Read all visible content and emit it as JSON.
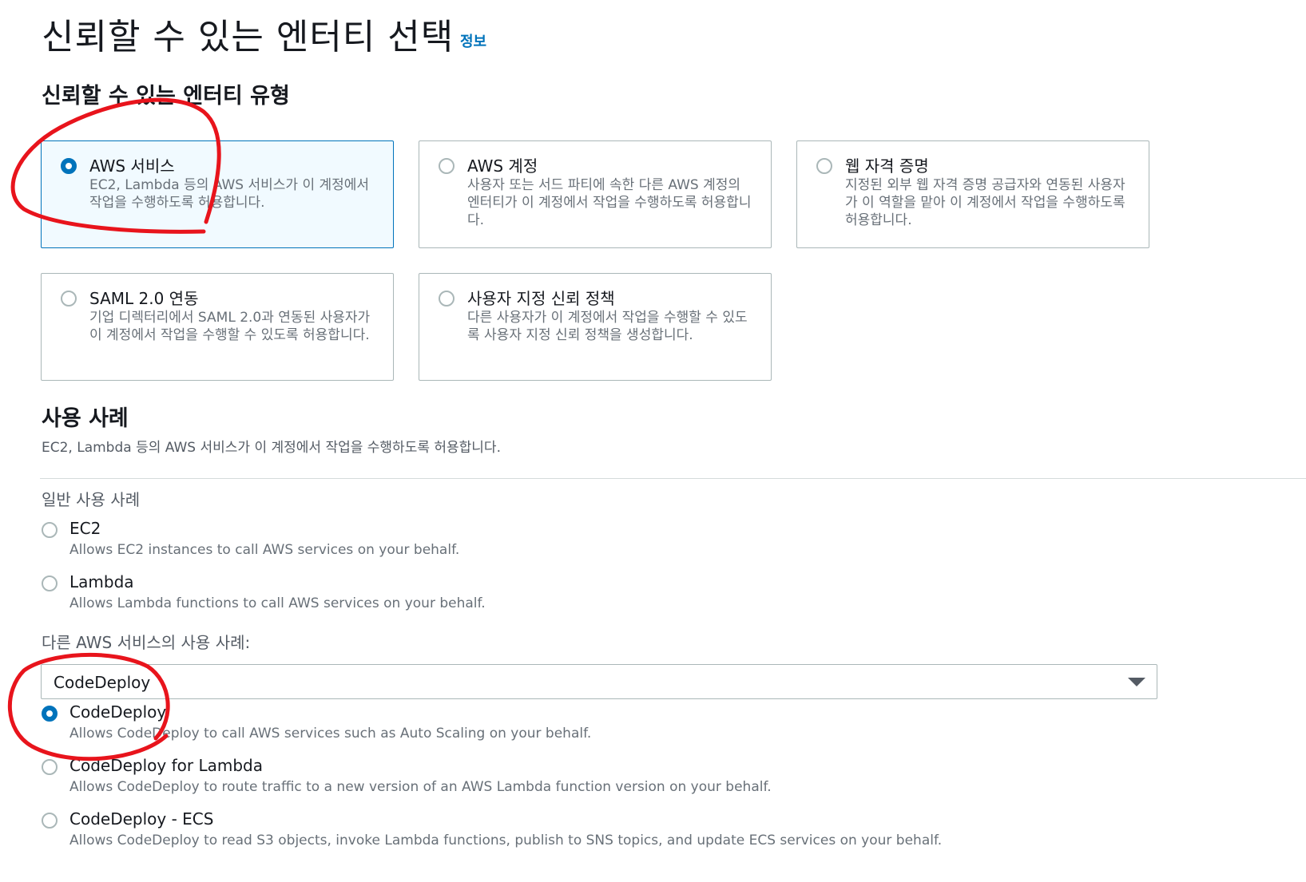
{
  "header": {
    "title": "신뢰할 수 있는 엔터티 선택",
    "info_link": "정보"
  },
  "entity_type": {
    "heading": "신뢰할 수 있는 엔터티 유형",
    "cards": [
      {
        "title": "AWS 서비스",
        "desc": "EC2, Lambda 등의 AWS 서비스가 이 계정에서 작업을 수행하도록 허용합니다.",
        "selected": true
      },
      {
        "title": "AWS 계정",
        "desc": "사용자 또는 서드 파티에 속한 다른 AWS 계정의 엔터티가 이 계정에서 작업을 수행하도록 허용합니다.",
        "selected": false
      },
      {
        "title": "웹 자격 증명",
        "desc": "지정된 외부 웹 자격 증명 공급자와 연동된 사용자가 이 역할을 맡아 이 계정에서 작업을 수행하도록 허용합니다.",
        "selected": false
      },
      {
        "title": "SAML 2.0 연동",
        "desc": "기업 디렉터리에서 SAML 2.0과 연동된 사용자가 이 계정에서 작업을 수행할 수 있도록 허용합니다.",
        "selected": false
      },
      {
        "title": "사용자 지정 신뢰 정책",
        "desc": "다른 사용자가 이 계정에서 작업을 수행할 수 있도록 사용자 지정 신뢰 정책을 생성합니다.",
        "selected": false
      }
    ]
  },
  "use_case": {
    "heading": "사용 사례",
    "subtitle": "EC2, Lambda 등의 AWS 서비스가 이 계정에서 작업을 수행하도록 허용합니다.",
    "common_label": "일반 사용 사례",
    "common": [
      {
        "title": "EC2",
        "desc": "Allows EC2 instances to call AWS services on your behalf.",
        "selected": false
      },
      {
        "title": "Lambda",
        "desc": "Allows Lambda functions to call AWS services on your behalf.",
        "selected": false
      }
    ],
    "other_label": "다른 AWS 서비스의 사용 사례:",
    "select_value": "CodeDeploy",
    "options": [
      {
        "title": "CodeDeploy",
        "desc": "Allows CodeDeploy to call AWS services such as Auto Scaling on your behalf.",
        "selected": true
      },
      {
        "title": "CodeDeploy for Lambda",
        "desc": "Allows CodeDeploy to route traffic to a new version of an AWS Lambda function version on your behalf.",
        "selected": false
      },
      {
        "title": "CodeDeploy - ECS",
        "desc": "Allows CodeDeploy to read S3 objects, invoke Lambda functions, publish to SNS topics, and update ECS services on your behalf.",
        "selected": false
      }
    ]
  },
  "colors": {
    "accent": "#0073bb",
    "selected_bg": "#f1faff",
    "annotation": "#e8141c"
  }
}
